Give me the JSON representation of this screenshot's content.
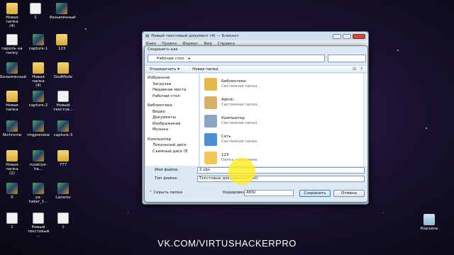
{
  "desktop_icons": [
    {
      "label": "Новая папка\n(4)",
      "kind": "folder"
    },
    {
      "label": "1",
      "kind": "doc"
    },
    {
      "label": "безымянный",
      "kind": "img"
    },
    {
      "label": "пароль на\nпапку",
      "kind": "doc"
    },
    {
      "label": "capture-1",
      "kind": "img"
    },
    {
      "label": "123",
      "kind": "folder"
    },
    {
      "label": "Безымянный",
      "kind": "img"
    },
    {
      "label": "Новая папка\n(4)",
      "kind": "folder"
    },
    {
      "label": "GodMode",
      "kind": "folder"
    },
    {
      "label": "Новая папка",
      "kind": "folder"
    },
    {
      "label": "capture-2",
      "kind": "img"
    },
    {
      "label": "Новый\nтекстов...",
      "kind": "doc"
    },
    {
      "label": "Nichrome",
      "kind": "img"
    },
    {
      "label": "imgpreview",
      "kind": "img"
    },
    {
      "label": "capture-3",
      "kind": "img"
    },
    {
      "label": "Новая папка\n(2)",
      "kind": "folder"
    },
    {
      "label": "russkiye-ha...",
      "kind": "img"
    },
    {
      "label": "777",
      "kind": "folder"
    },
    {
      "label": "0",
      "kind": "img"
    },
    {
      "label": "ya-haker_1...",
      "kind": "img"
    },
    {
      "label": "Lazarev",
      "kind": "img"
    },
    {
      "label": "1",
      "kind": "doc"
    },
    {
      "label": "Новый\nтекстовый ...",
      "kind": "doc"
    },
    {
      "label": "1",
      "kind": "doc"
    },
    {
      "label": "Корзина",
      "kind": "recycle"
    }
  ],
  "notepad": {
    "title": "Новый текстовый документ (4) — Блокнот",
    "menu": [
      "Файл",
      "Правка",
      "Формат",
      "Вид",
      "Справка"
    ]
  },
  "dialog": {
    "title": "Сохранить как",
    "address": "Рабочий стол",
    "toolbar": {
      "organize": "Упорядочить ▾",
      "new_folder": "Новая папка"
    },
    "nav": [
      {
        "label": "Избранное",
        "group": true
      },
      {
        "label": "Загрузки"
      },
      {
        "label": "Недавние места"
      },
      {
        "label": "Рабочий стол"
      },
      {
        "label": "",
        "sep": true
      },
      {
        "label": "Библиотеки",
        "group": true
      },
      {
        "label": "Видео"
      },
      {
        "label": "Документы"
      },
      {
        "label": "Изображения"
      },
      {
        "label": "Музыка"
      },
      {
        "label": "",
        "sep": true
      },
      {
        "label": "Компьютер",
        "group": true
      },
      {
        "label": "Локальный диск"
      },
      {
        "label": "Съемный диск (E"
      }
    ],
    "items": [
      {
        "name": "Библиотеки",
        "sub": "Системная папка",
        "color": "#e3b84a"
      },
      {
        "name": "Admin",
        "sub": "Системная папка",
        "color": "#d8b06a"
      },
      {
        "name": "Компьютер",
        "sub": "Системная папка",
        "color": "#8aa6c0"
      },
      {
        "name": "Сеть",
        "sub": "Системная папка",
        "color": "#4f8fd0"
      },
      {
        "name": "123",
        "sub": "Папка с файлами",
        "color": "#f0c95a"
      }
    ],
    "filename_label": "Имя файла:",
    "filename_value": "2.vbs",
    "filetype_label": "Тип файла:",
    "filetype_value": "Текстовые документы (*.txt)",
    "hide_folders": "Скрыть папки",
    "encoding_label": "Кодировка:",
    "encoding_value": "ANSI",
    "save": "Сохранить",
    "cancel": "Отмена"
  },
  "watermark": "VK.COM/VIRTUSHACKERPRO"
}
